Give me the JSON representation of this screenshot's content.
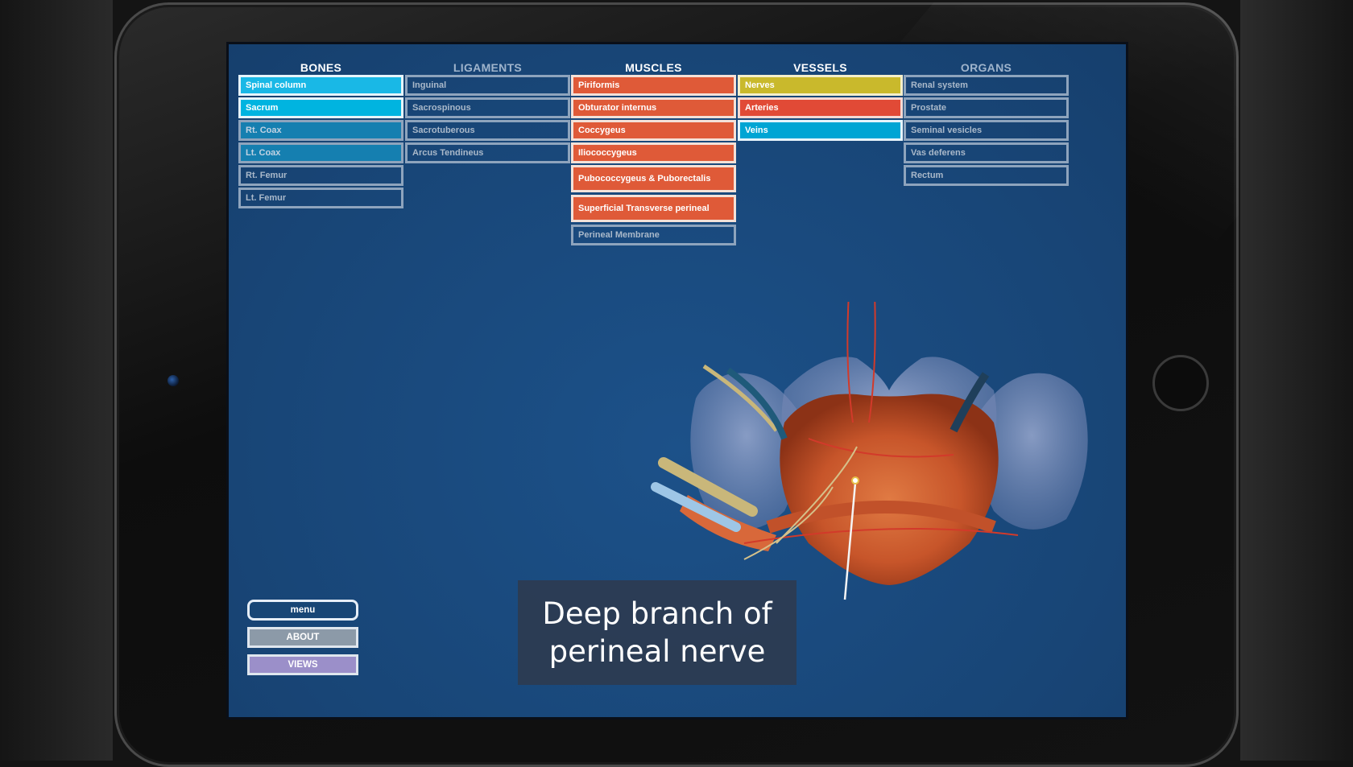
{
  "columns": [
    {
      "key": "bones",
      "header": "BONES",
      "header_active": true,
      "items": [
        {
          "label": "Spinal column",
          "state": "cyan"
        },
        {
          "label": "Sacrum",
          "state": "cyan2"
        },
        {
          "label": "Rt. Coax",
          "state": "teal"
        },
        {
          "label": "Lt. Coax",
          "state": "teal"
        },
        {
          "label": "Rt. Femur",
          "state": "inactive"
        },
        {
          "label": "Lt. Femur",
          "state": "inactive"
        }
      ]
    },
    {
      "key": "ligaments",
      "header": "LIGAMENTS",
      "header_active": false,
      "items": [
        {
          "label": "Inguinal",
          "state": "inactive"
        },
        {
          "label": "Sacrospinous",
          "state": "inactive"
        },
        {
          "label": "Sacrotuberous",
          "state": "inactive"
        },
        {
          "label": "Arcus Tendineus",
          "state": "inactive"
        }
      ]
    },
    {
      "key": "muscles",
      "header": "MUSCLES",
      "header_active": true,
      "items": [
        {
          "label": "Piriformis",
          "state": "orange"
        },
        {
          "label": "Obturator internus",
          "state": "orange"
        },
        {
          "label": "Coccygeus",
          "state": "orange"
        },
        {
          "label": "Iliococcygeus",
          "state": "orange"
        },
        {
          "label": "Pubococcygeus & Puborectalis",
          "state": "orange",
          "tall": true
        },
        {
          "label": "Superficial Transverse perineal",
          "state": "orange",
          "tall": true
        },
        {
          "label": "Perineal Membrane",
          "state": "inactive"
        }
      ]
    },
    {
      "key": "vessels",
      "header": "VESSELS",
      "header_active": true,
      "items": [
        {
          "label": "Nerves",
          "state": "yellow"
        },
        {
          "label": "Arteries",
          "state": "red"
        },
        {
          "label": "Veins",
          "state": "blue"
        }
      ]
    },
    {
      "key": "organs",
      "header": "ORGANS",
      "header_active": false,
      "items": [
        {
          "label": "Renal system",
          "state": "inactive"
        },
        {
          "label": "Prostate",
          "state": "inactive"
        },
        {
          "label": "Seminal vesicles",
          "state": "inactive"
        },
        {
          "label": "Vas deferens",
          "state": "inactive"
        },
        {
          "label": "Rectum",
          "state": "inactive"
        }
      ]
    }
  ],
  "buttons": {
    "menu": "menu",
    "about": "ABOUT",
    "views": "VIEWS"
  },
  "caption": {
    "line1": "Deep branch of",
    "line2": "perineal nerve"
  },
  "colors": {
    "screen_bg": "#1a4a7f",
    "bones_active": "#19b8e6",
    "muscles_active": "#df5a38",
    "nerves": "#c9b92c",
    "arteries": "#e14a36",
    "veins": "#00a5d4"
  },
  "icons": {
    "camera": "front-camera-icon",
    "home": "home-button-icon"
  }
}
